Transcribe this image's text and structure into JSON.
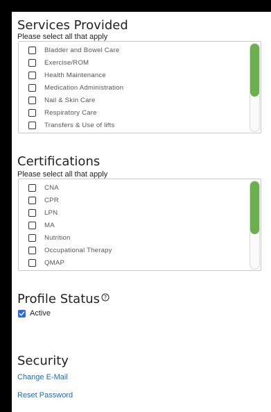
{
  "services": {
    "title": "Services Provided",
    "hint": "Please select all that apply",
    "items": [
      "Bladder and Bowel Care",
      "Exercise/ROM",
      "Health Maintenance",
      "Medication Administration",
      "Nail & Skin Care",
      "Respiratory Care",
      "Transfers & Use of lifts"
    ]
  },
  "certifications": {
    "title": "Certifications",
    "hint": "Please select all that apply",
    "items": [
      "CNA",
      "CPR",
      "LPN",
      "MA",
      "Nutrition",
      "Occupational Therapy",
      "QMAP"
    ]
  },
  "profile_status": {
    "title": "Profile Status",
    "help_icon": "help-circle-icon",
    "active_label": "Active",
    "active_checked": true
  },
  "security": {
    "title": "Security",
    "change_email": "Change E-Mail",
    "reset_password": "Reset Password"
  },
  "colors": {
    "accent_green": "#6ab04c",
    "checkbox_blue": "#2e6bd8",
    "link_blue": "#1a6bbd"
  }
}
